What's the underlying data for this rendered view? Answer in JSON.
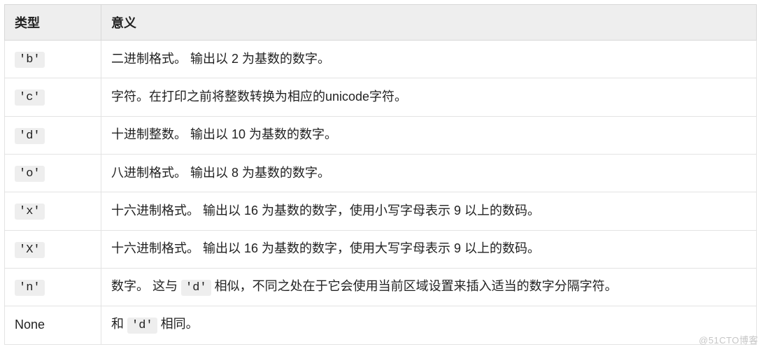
{
  "table": {
    "headers": {
      "type": "类型",
      "meaning": "意义"
    },
    "rows": [
      {
        "type_code": "'b'",
        "type_plain": null,
        "meaning_pre": "二进制格式。 输出以 2 为基数的数字。",
        "meaning_code": null,
        "meaning_post": null
      },
      {
        "type_code": "'c'",
        "type_plain": null,
        "meaning_pre": "字符。在打印之前将整数转换为相应的unicode字符。",
        "meaning_code": null,
        "meaning_post": null
      },
      {
        "type_code": "'d'",
        "type_plain": null,
        "meaning_pre": "十进制整数。 输出以 10 为基数的数字。",
        "meaning_code": null,
        "meaning_post": null
      },
      {
        "type_code": "'o'",
        "type_plain": null,
        "meaning_pre": "八进制格式。 输出以 8 为基数的数字。",
        "meaning_code": null,
        "meaning_post": null
      },
      {
        "type_code": "'x'",
        "type_plain": null,
        "meaning_pre": "十六进制格式。 输出以 16 为基数的数字，使用小写字母表示 9 以上的数码。",
        "meaning_code": null,
        "meaning_post": null
      },
      {
        "type_code": "'X'",
        "type_plain": null,
        "meaning_pre": "十六进制格式。 输出以 16 为基数的数字，使用大写字母表示 9 以上的数码。",
        "meaning_code": null,
        "meaning_post": null
      },
      {
        "type_code": "'n'",
        "type_plain": null,
        "meaning_pre": "数字。 这与 ",
        "meaning_code": "'d'",
        "meaning_post": " 相似，不同之处在于它会使用当前区域设置来插入适当的数字分隔字符。"
      },
      {
        "type_code": null,
        "type_plain": "None",
        "meaning_pre": "和 ",
        "meaning_code": "'d'",
        "meaning_post": " 相同。"
      }
    ]
  },
  "watermark": "@51CTO博客"
}
